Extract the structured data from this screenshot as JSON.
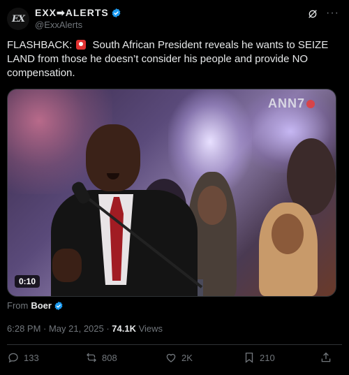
{
  "author": {
    "avatar_text": "EX",
    "name": "EXX➡ALERTS",
    "handle": "@ExxAlerts"
  },
  "tweet": {
    "text_before": "FLASHBACK:",
    "text_after": "South African President reveals he wants to SEIZE LAND from those he doesn’t consider his people and provide NO compensation."
  },
  "media": {
    "duration": "0:10",
    "watermark": "ANN7"
  },
  "source": {
    "prefix": "From",
    "name": "Boer"
  },
  "meta": {
    "timestamp": "6:28 PM · May 21, 2025 · ",
    "views_count": "74.1K",
    "views_label": " Views"
  },
  "actions": {
    "replies": "133",
    "reposts": "808",
    "likes": "2K",
    "bookmarks": "210"
  },
  "colors": {
    "background": "#000000",
    "text": "#e7e9ea",
    "muted": "#71767b",
    "verified": "#1d9bf0",
    "border": "#2f3336"
  }
}
